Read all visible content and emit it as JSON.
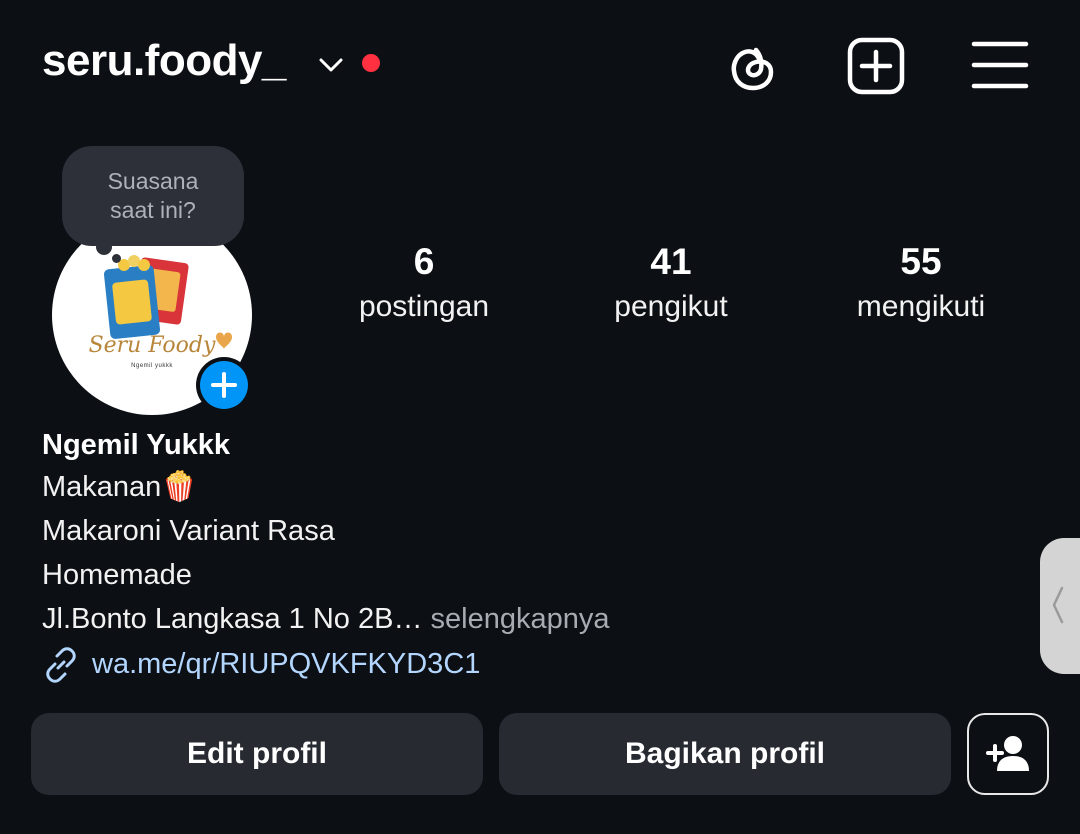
{
  "header": {
    "username": "seru.foody_",
    "icons": [
      "chevron-down-icon",
      "notification-dot",
      "threads-icon",
      "add-post-icon",
      "menu-icon"
    ],
    "notification_color": "#ff3040"
  },
  "note": {
    "placeholder_line1": "Suasana",
    "placeholder_line2": "saat ini?"
  },
  "avatar": {
    "brand_text": "Seru Foody",
    "tagline": "Ngemil yukkk",
    "add_story_icon": "plus-icon"
  },
  "stats": [
    {
      "value": "6",
      "label": "postingan"
    },
    {
      "value": "41",
      "label": "pengikut"
    },
    {
      "value": "55",
      "label": "mengikuti"
    }
  ],
  "bio": {
    "name": "Ngemil Yukkk",
    "line1": "Makanan🍿",
    "line2": "Makaroni Variant Rasa",
    "line3": "Homemade",
    "line4": "Jl.Bonto Langkasa 1 No 2B…",
    "more": "selengkapnya",
    "link": "wa.me/qr/RIUPQVKFKYD3C1"
  },
  "actions": {
    "edit_profile": "Edit profil",
    "share_profile": "Bagikan profil",
    "add_user_icon": "add-person-icon"
  },
  "colors": {
    "background": "#0c0f14",
    "button": "#272a31",
    "accent_blue": "#0095f6",
    "link": "#b3d6ff"
  }
}
